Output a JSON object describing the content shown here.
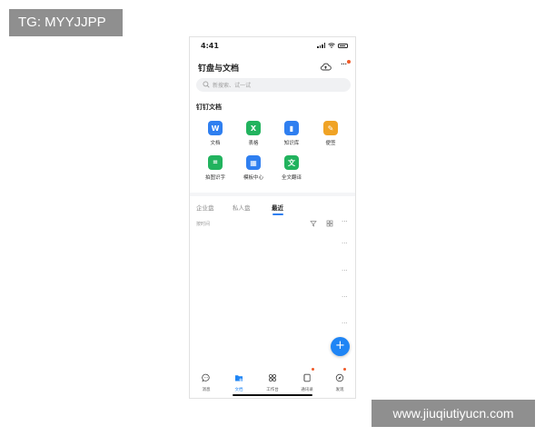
{
  "watermarks": {
    "top": "TG: MYYJJPP",
    "bottom": "www.jiuqiutiyucn.com"
  },
  "status_bar": {
    "time": "4:41"
  },
  "header": {
    "title": "钉盘与文档",
    "cloud_icon": "cloud-upload-icon",
    "more_icon": "more-icon"
  },
  "search": {
    "placeholder": "新搜索、试一试"
  },
  "section": {
    "title": "钉钉文档"
  },
  "tiles": [
    {
      "label": "文档",
      "glyph": "W",
      "icon": "doc-icon",
      "color": "#2f7ff0"
    },
    {
      "label": "表格",
      "glyph": "X",
      "icon": "sheet-icon",
      "color": "#22b35e"
    },
    {
      "label": "知识库",
      "glyph": "▮",
      "icon": "knowledge-icon",
      "color": "#2f7ff0"
    },
    {
      "label": "便签",
      "glyph": "✎",
      "icon": "note-icon",
      "color": "#f0a325"
    },
    {
      "label": "拍图识字",
      "glyph": "⌗",
      "icon": "ocr-icon",
      "color": "#22b35e"
    },
    {
      "label": "模板中心",
      "glyph": "▦",
      "icon": "template-icon",
      "color": "#2f7ff0"
    },
    {
      "label": "全文翻译",
      "glyph": "文",
      "icon": "translate-icon",
      "color": "#22b35e"
    }
  ],
  "tabs": [
    {
      "label": "企业盘",
      "active": false
    },
    {
      "label": "私人盘",
      "active": false
    },
    {
      "label": "最近",
      "active": true
    }
  ],
  "sort": {
    "label": "按时间",
    "more": "···"
  },
  "rows": [
    {
      "more": "···"
    },
    {
      "more": "···"
    },
    {
      "more": "···"
    },
    {
      "more": "···"
    }
  ],
  "fab": {
    "label": "+"
  },
  "tabbar": [
    {
      "label": "消息",
      "icon": "chat-icon",
      "active": false,
      "dot": false
    },
    {
      "label": "文档",
      "icon": "folder-icon",
      "active": true,
      "dot": false
    },
    {
      "label": "工作台",
      "icon": "apps-icon",
      "active": false,
      "dot": false
    },
    {
      "label": "通讯录",
      "icon": "contacts-icon",
      "active": false,
      "dot": true
    },
    {
      "label": "发现",
      "icon": "compass-icon",
      "active": false,
      "dot": true
    }
  ],
  "colors": {
    "accent": "#1f85f5",
    "badge": "#f05a28"
  }
}
